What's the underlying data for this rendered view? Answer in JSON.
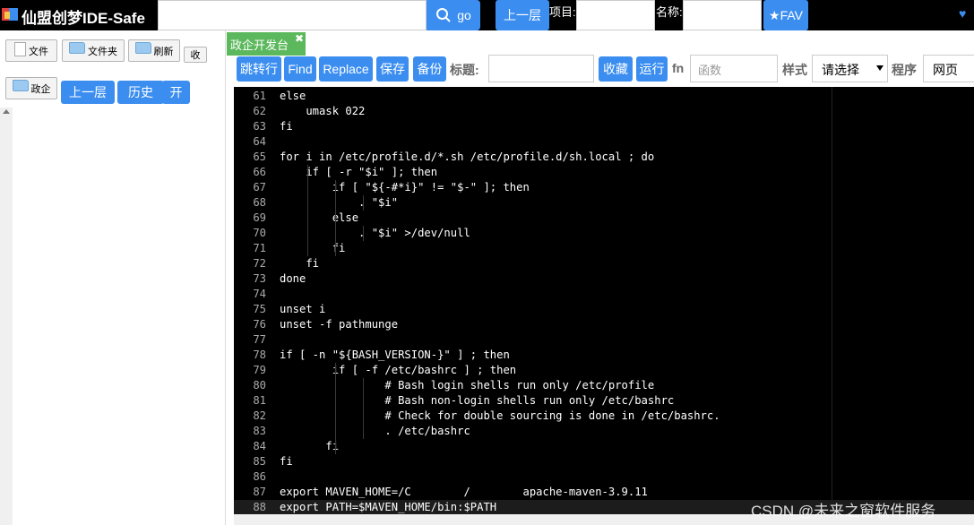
{
  "topbar": {
    "title": "仙盟创梦IDE-Safe",
    "search_value": "",
    "go_label": "go",
    "up_label": "上一层",
    "project_label": "项目:",
    "project_value": "",
    "name_label": "名称:",
    "name_value": "",
    "fav_label": "★FAV",
    "heart": "♥"
  },
  "left_panel": {
    "file_label": "文件",
    "folder_label": "文件夹",
    "refresh_label": "刷新",
    "collapse_label": "收",
    "gov_label": "政企",
    "up_label": "上一层",
    "history_label": "历史",
    "open_label": "开"
  },
  "tab": {
    "label": "政企开发台",
    "close": "✖"
  },
  "toolbar": {
    "goto_label": "跳转行",
    "find_label": "Find",
    "replace_label": "Replace",
    "save_label": "保存",
    "backup_label": "备份",
    "title_label": "标题:",
    "title_value": "",
    "collect_label": "收藏",
    "run_label": "运行",
    "fn_label": "fn",
    "fn_placeholder": "函数",
    "style_label": "样式",
    "style_value": "请选择",
    "program_label": "程序",
    "program_value": "网页"
  },
  "editor": {
    "lines": [
      {
        "n": "61",
        "t": "else"
      },
      {
        "n": "62",
        "t": "    umask 022"
      },
      {
        "n": "63",
        "t": "fi"
      },
      {
        "n": "64",
        "t": ""
      },
      {
        "n": "65",
        "t": "for i in /etc/profile.d/*.sh /etc/profile.d/sh.local ; do"
      },
      {
        "n": "66",
        "t": "    if [ -r \"$i\" ]; then"
      },
      {
        "n": "67",
        "t": "        if [ \"${-#*i}\" != \"$-\" ]; then"
      },
      {
        "n": "68",
        "t": "            . \"$i\""
      },
      {
        "n": "69",
        "t": "        else"
      },
      {
        "n": "70",
        "t": "            . \"$i\" >/dev/null"
      },
      {
        "n": "71",
        "t": "        fi"
      },
      {
        "n": "72",
        "t": "    fi"
      },
      {
        "n": "73",
        "t": "done"
      },
      {
        "n": "74",
        "t": ""
      },
      {
        "n": "75",
        "t": "unset i"
      },
      {
        "n": "76",
        "t": "unset -f pathmunge"
      },
      {
        "n": "77",
        "t": ""
      },
      {
        "n": "78",
        "t": "if [ -n \"${BASH_VERSION-}\" ] ; then"
      },
      {
        "n": "79",
        "t": "        if [ -f /etc/bashrc ] ; then"
      },
      {
        "n": "80",
        "t": "                # Bash login shells run only /etc/profile"
      },
      {
        "n": "81",
        "t": "                # Bash non-login shells run only /etc/bashrc"
      },
      {
        "n": "82",
        "t": "                # Check for double sourcing is done in /etc/bashrc."
      },
      {
        "n": "83",
        "t": "                . /etc/bashrc"
      },
      {
        "n": "84",
        "t": "       fi"
      },
      {
        "n": "85",
        "t": "fi"
      },
      {
        "n": "86",
        "t": ""
      },
      {
        "n": "87",
        "t": "export MAVEN_HOME=/C        /        apache-maven-3.9.11"
      },
      {
        "n": "88",
        "t": "export PATH=$MAVEN_HOME/bin:$PATH"
      }
    ],
    "active_line": "88"
  },
  "watermark": "CSDN @未来之窗软件服务",
  "colors": {
    "accent": "#3b8ef0",
    "tab_green": "#5cb85c",
    "topbar": "#000000",
    "editor_bg": "#000000"
  }
}
